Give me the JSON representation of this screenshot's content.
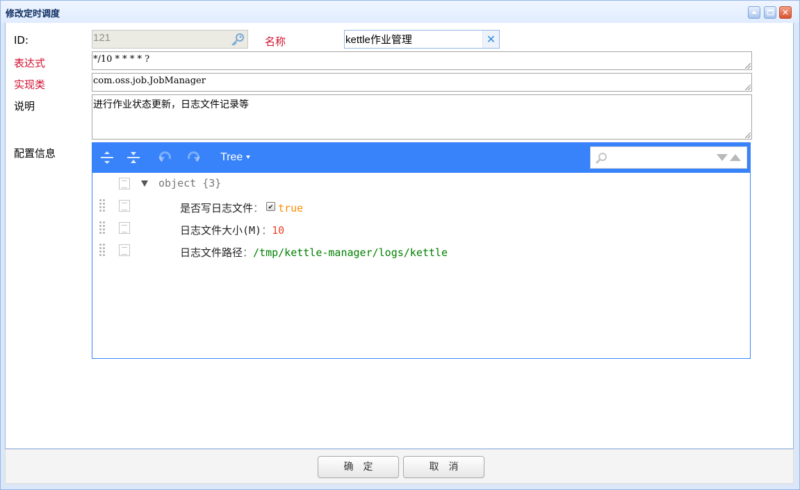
{
  "window": {
    "title": "修改定时调度"
  },
  "form": {
    "id": {
      "label": "ID:",
      "value": "121"
    },
    "name": {
      "label": "名称",
      "value": "kettle作业管理",
      "clear_icon": "close-icon"
    },
    "expression": {
      "label": "表达式",
      "value": "*/10 * * * * ?"
    },
    "impl_class": {
      "label": "实现类",
      "value": "com.oss.job.JobManager"
    },
    "description": {
      "label": "说明",
      "value": "进行作业状态更新，日志文件记录等"
    },
    "config": {
      "label": "配置信息"
    }
  },
  "json_editor": {
    "mode_label": "Tree",
    "search": {
      "placeholder": "",
      "value": ""
    },
    "root": {
      "text": "object {3}"
    },
    "fields": [
      {
        "key": "是否写日志文件",
        "type": "boolean",
        "value": "true",
        "checked": true
      },
      {
        "key": "日志文件大小(M)",
        "type": "number",
        "value": "10"
      },
      {
        "key": "日志文件路径",
        "type": "string",
        "value": "/tmp/kettle-manager/logs/kettle"
      }
    ],
    "colors": {
      "menu": "#3883fa",
      "boolean": "#ff8c00",
      "number": "#ee422e",
      "string": "#008000"
    }
  },
  "footer": {
    "ok_label": "确定",
    "cancel_label": "取消"
  },
  "colors": {
    "required_label": "#d0122f",
    "window_border": "#95b8e7"
  }
}
